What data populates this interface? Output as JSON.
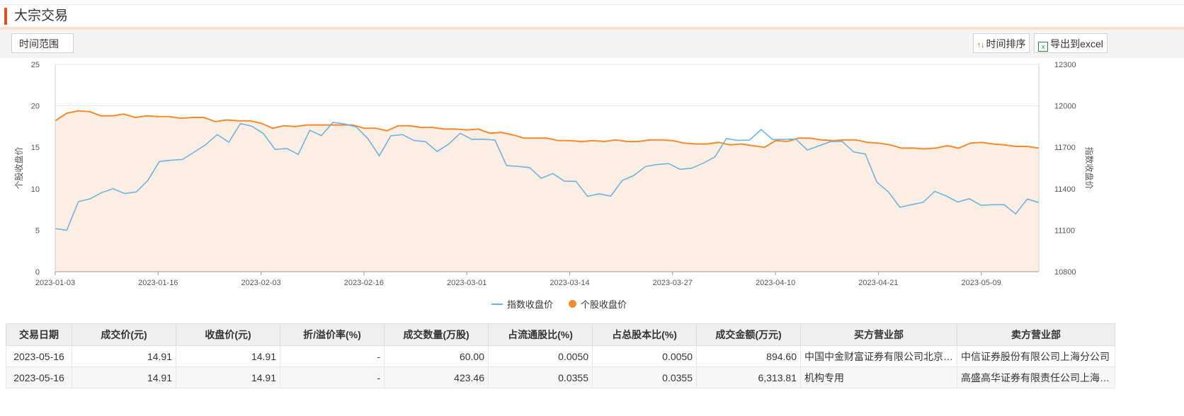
{
  "header": {
    "title": "大宗交易"
  },
  "toolbar": {
    "range_label": "时间范围",
    "sort_label": "时间排序",
    "export_label": "导出到excel"
  },
  "chart_data": {
    "type": "line",
    "title": "",
    "left_axis": {
      "label": "个股收盘价",
      "ylim": [
        0,
        25
      ],
      "ticks": [
        0,
        5,
        10,
        15,
        20,
        25
      ]
    },
    "right_axis": {
      "label": "指数收盘价",
      "ylim": [
        10800,
        12300
      ],
      "ticks": [
        10800,
        11100,
        11400,
        11700,
        12000,
        12300
      ]
    },
    "x_tick_labels": [
      "2023-01-03",
      "2023-01-16",
      "2023-02-03",
      "2023-02-16",
      "2023-03-01",
      "2023-03-14",
      "2023-03-27",
      "2023-04-10",
      "2023-04-21",
      "2023-05-09"
    ],
    "grid": true,
    "legend_position": "bottom-center",
    "colors": {
      "index": "#6cb3e0",
      "stock": "#f58a2e",
      "stock_fill": "#fdeee3"
    },
    "series": [
      {
        "name": "指数收盘价",
        "axis": "right",
        "values": [
          11112,
          11100,
          11307,
          11327,
          11372,
          11400,
          11365,
          11377,
          11460,
          11597,
          11607,
          11612,
          11665,
          11719,
          11792,
          11737,
          11872,
          11852,
          11799,
          11684,
          11692,
          11649,
          11823,
          11785,
          11880,
          11869,
          11848,
          11765,
          11638,
          11783,
          11792,
          11749,
          11741,
          11670,
          11723,
          11802,
          11758,
          11759,
          11752,
          11568,
          11562,
          11553,
          11476,
          11510,
          11455,
          11453,
          11345,
          11363,
          11347,
          11460,
          11496,
          11560,
          11575,
          11582,
          11541,
          11549,
          11585,
          11630,
          11763,
          11749,
          11752,
          11828,
          11756,
          11758,
          11760,
          11680,
          11711,
          11741,
          11743,
          11666,
          11652,
          11448,
          11377,
          11266,
          11285,
          11302,
          11381,
          11348,
          11304,
          11328,
          11280,
          11285,
          11285,
          11218,
          11326,
          11300
        ]
      },
      {
        "name": "个股收盘价",
        "axis": "left",
        "values": [
          18.2,
          19.1,
          19.4,
          19.3,
          18.8,
          18.8,
          19.0,
          18.6,
          18.8,
          18.7,
          18.7,
          18.5,
          18.6,
          18.6,
          18.1,
          18.3,
          18.2,
          18.2,
          17.9,
          17.3,
          17.6,
          17.5,
          17.7,
          17.7,
          17.7,
          17.7,
          17.7,
          17.3,
          17.3,
          17.0,
          17.6,
          17.6,
          17.4,
          17.4,
          17.2,
          17.2,
          17.1,
          17.2,
          16.7,
          16.8,
          16.5,
          16.1,
          16.1,
          16.1,
          15.8,
          15.8,
          15.7,
          15.8,
          15.7,
          15.9,
          15.7,
          15.7,
          15.9,
          15.9,
          15.8,
          15.5,
          15.4,
          15.4,
          15.6,
          15.3,
          15.4,
          15.2,
          15.0,
          15.8,
          15.7,
          16.1,
          16.1,
          15.9,
          15.8,
          15.9,
          15.9,
          15.6,
          15.5,
          15.3,
          14.9,
          14.9,
          14.8,
          14.9,
          15.2,
          14.9,
          15.5,
          15.6,
          15.4,
          15.3,
          15.1,
          15.1,
          14.9
        ]
      }
    ]
  },
  "table": {
    "columns": [
      "交易日期",
      "成交价(元)",
      "收盘价(元)",
      "折/溢价率(%)",
      "成交数量(万股)",
      "占流通股比(%)",
      "占总股本比(%)",
      "成交金额(万元)",
      "买方营业部",
      "卖方营业部"
    ],
    "rows": [
      [
        "2023-05-16",
        "14.91",
        "14.91",
        "-",
        "60.00",
        "0.0050",
        "0.0050",
        "894.60",
        "中国中金财富证券有限公司北京北三环中路证券营业部",
        "中信证券股份有限公司上海分公司"
      ],
      [
        "2023-05-16",
        "14.91",
        "14.91",
        "-",
        "423.46",
        "0.0355",
        "0.0355",
        "6,313.81",
        "机构专用",
        "高盛高华证券有限责任公司上海浦东新区世纪大道证券营业部"
      ]
    ]
  }
}
